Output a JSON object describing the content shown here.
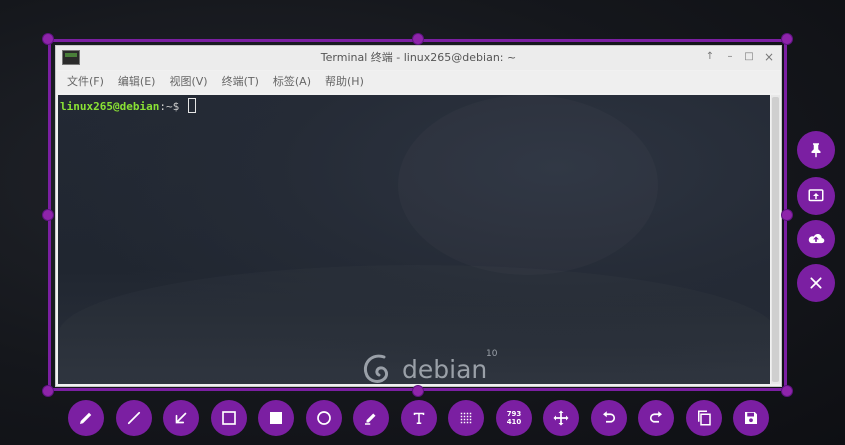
{
  "window": {
    "title": "Terminal 终端 - linux265@debian: ~",
    "buttons": {
      "keep_above": "↑",
      "minimize": "–",
      "maximize": "□",
      "close": "×"
    }
  },
  "menu": [
    {
      "label": "文件(F)"
    },
    {
      "label": "编辑(E)"
    },
    {
      "label": "视图(V)"
    },
    {
      "label": "终端(T)"
    },
    {
      "label": "标签(A)"
    },
    {
      "label": "帮助(H)"
    }
  ],
  "terminal": {
    "prompt_user": "linux265@debian",
    "prompt_path": ":~$ "
  },
  "wallpaper": {
    "brand": "debian",
    "version": "10"
  },
  "capture": {
    "size_readout_width": "793",
    "size_readout_height": "410",
    "accent_color": "#7b1fa2"
  },
  "side_actions": [
    {
      "icon": "pin-icon"
    },
    {
      "icon": "screen-copy-icon"
    },
    {
      "icon": "cloud-upload-icon"
    },
    {
      "icon": "close-icon"
    }
  ],
  "toolbar": [
    {
      "icon": "pencil-icon"
    },
    {
      "icon": "line-icon"
    },
    {
      "icon": "arrow-icon"
    },
    {
      "icon": "rectangle-icon"
    },
    {
      "icon": "filled-rectangle-icon"
    },
    {
      "icon": "circle-icon"
    },
    {
      "icon": "marker-icon"
    },
    {
      "icon": "text-icon"
    },
    {
      "icon": "pixelate-icon"
    },
    {
      "icon": "selection-size-icon"
    },
    {
      "icon": "move-icon"
    },
    {
      "icon": "undo-icon"
    },
    {
      "icon": "redo-icon"
    },
    {
      "icon": "copy-icon"
    },
    {
      "icon": "save-icon"
    }
  ]
}
